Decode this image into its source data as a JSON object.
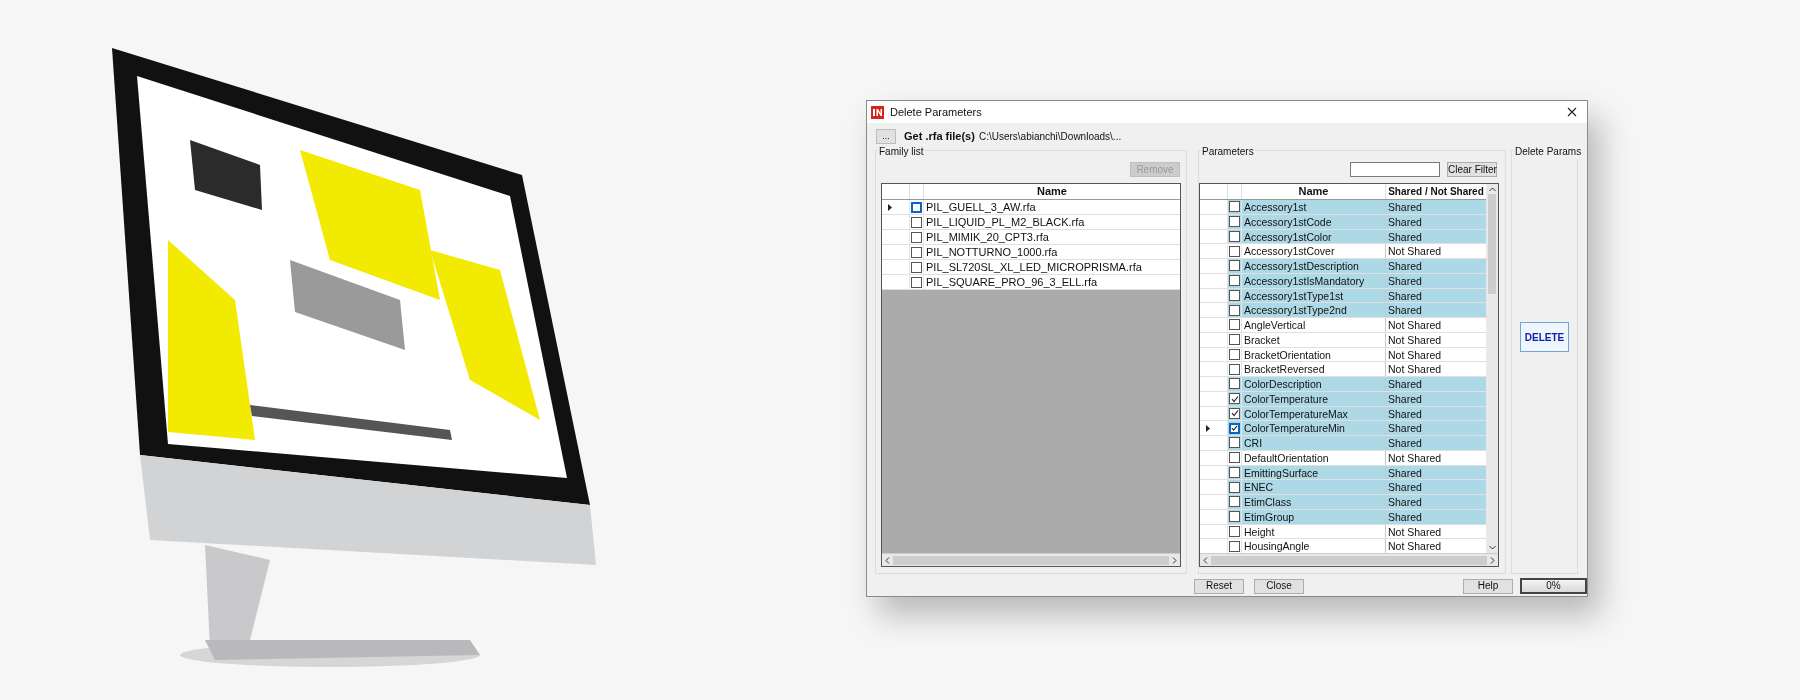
{
  "window": {
    "title": "Delete Parameters"
  },
  "toolbar": {
    "browse_button": "...",
    "label": "Get .rfa file(s)",
    "path": "C:\\Users\\abianchi\\Downloads\\..."
  },
  "family_list": {
    "title": "Family list",
    "remove_button": {
      "label": "Remove",
      "disabled": true
    },
    "column": "Name",
    "rows": [
      {
        "name": "PIL_GUELL_3_AW.rfa",
        "checked": false,
        "selected": true
      },
      {
        "name": "PIL_LIQUID_PL_M2_BLACK.rfa",
        "checked": false,
        "selected": false
      },
      {
        "name": "PIL_MIMIK_20_CPT3.rfa",
        "checked": false,
        "selected": false
      },
      {
        "name": "PIL_NOTTURNO_1000.rfa",
        "checked": false,
        "selected": false
      },
      {
        "name": "PIL_SL720SL_XL_LED_MICROPRISMA.rfa",
        "checked": false,
        "selected": false
      },
      {
        "name": "PIL_SQUARE_PRO_96_3_ELL.rfa",
        "checked": false,
        "selected": false
      }
    ]
  },
  "parameters": {
    "title": "Parameters",
    "clear_filter_button": "Clear Filter",
    "columns": [
      "Name",
      "Shared / Not Shared"
    ],
    "rows": [
      {
        "name": "Accessory1st",
        "shared": "Shared",
        "color": "#add8e6",
        "checked": false,
        "selected": false
      },
      {
        "name": "Accessory1stCode",
        "shared": "Shared",
        "color": "#add8e6",
        "checked": false,
        "selected": false
      },
      {
        "name": "Accessory1stColor",
        "shared": "Shared",
        "color": "#add8e6",
        "checked": false,
        "selected": false
      },
      {
        "name": "Accessory1stCover",
        "shared": "Not Shared",
        "color": "#ffffff",
        "checked": false,
        "selected": false
      },
      {
        "name": "Accessory1stDescription",
        "shared": "Shared",
        "color": "#add8e6",
        "checked": false,
        "selected": false
      },
      {
        "name": "Accessory1stIsMandatory",
        "shared": "Shared",
        "color": "#add8e6",
        "checked": false,
        "selected": false
      },
      {
        "name": "Accessory1stType1st",
        "shared": "Shared",
        "color": "#add8e6",
        "checked": false,
        "selected": false
      },
      {
        "name": "Accessory1stType2nd",
        "shared": "Shared",
        "color": "#add8e6",
        "checked": false,
        "selected": false
      },
      {
        "name": "AngleVertical",
        "shared": "Not Shared",
        "color": "#ffffff",
        "checked": false,
        "selected": false
      },
      {
        "name": "Bracket",
        "shared": "Not Shared",
        "color": "#ffffff",
        "checked": false,
        "selected": false
      },
      {
        "name": "BracketOrientation",
        "shared": "Not Shared",
        "color": "#ffffff",
        "checked": false,
        "selected": false
      },
      {
        "name": "BracketReversed",
        "shared": "Not Shared",
        "color": "#ffffff",
        "checked": false,
        "selected": false
      },
      {
        "name": "ColorDescription",
        "shared": "Shared",
        "color": "#add8e6",
        "checked": false,
        "selected": false
      },
      {
        "name": "ColorTemperature",
        "shared": "Shared",
        "color": "#add8e6",
        "checked": true,
        "selected": false
      },
      {
        "name": "ColorTemperatureMax",
        "shared": "Shared",
        "color": "#add8e6",
        "checked": true,
        "selected": false
      },
      {
        "name": "ColorTemperatureMin",
        "shared": "Shared",
        "color": "#add8e6",
        "checked": true,
        "selected": true
      },
      {
        "name": "CRI",
        "shared": "Shared",
        "color": "#add8e6",
        "checked": false,
        "selected": false
      },
      {
        "name": "DefaultOrientation",
        "shared": "Not Shared",
        "color": "#ffffff",
        "checked": false,
        "selected": false
      },
      {
        "name": "EmittingSurface",
        "shared": "Shared",
        "color": "#add8e6",
        "checked": false,
        "selected": false
      },
      {
        "name": "ENEC",
        "shared": "Shared",
        "color": "#add8e6",
        "checked": false,
        "selected": false
      },
      {
        "name": "EtimClass",
        "shared": "Shared",
        "color": "#add8e6",
        "checked": false,
        "selected": false
      },
      {
        "name": "EtimGroup",
        "shared": "Shared",
        "color": "#add8e6",
        "checked": false,
        "selected": false
      },
      {
        "name": "Height",
        "shared": "Not Shared",
        "color": "#ffffff",
        "checked": false,
        "selected": false
      },
      {
        "name": "HousingAngle",
        "shared": "Not Shared",
        "color": "#ffffff",
        "checked": false,
        "selected": false
      }
    ]
  },
  "delete_params": {
    "title": "Delete Params",
    "delete_button": "DELETE"
  },
  "footer": {
    "buttons": [
      "Reset",
      "Close"
    ],
    "help_button": "Help",
    "progress": {
      "level": 0,
      "reading": "0%"
    }
  }
}
